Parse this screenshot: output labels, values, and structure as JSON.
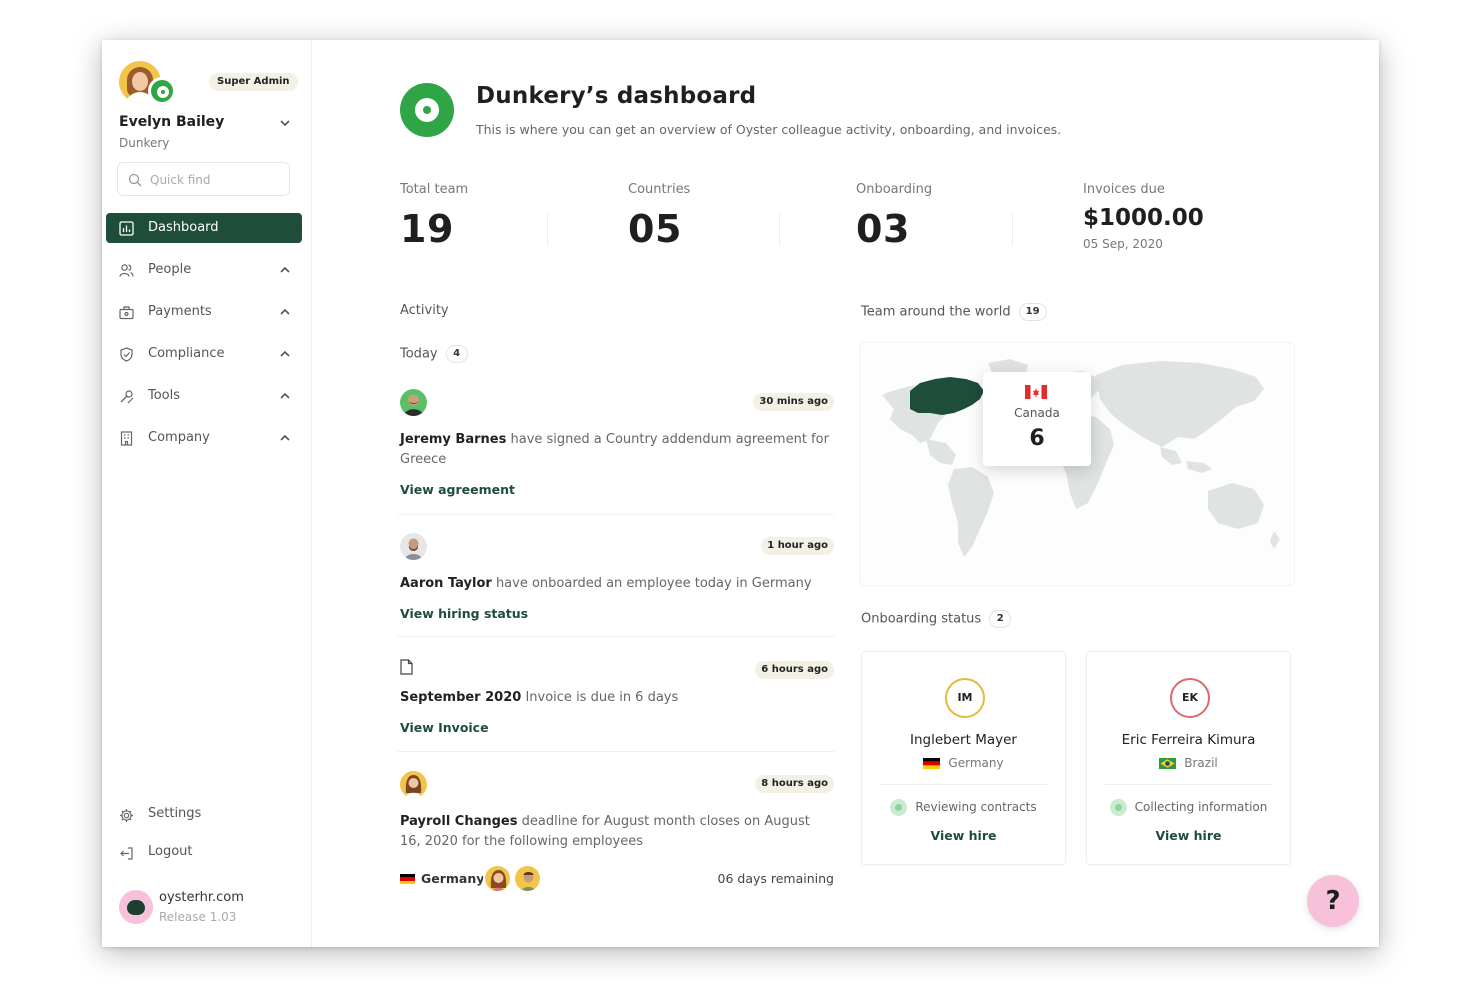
{
  "user": {
    "name": "Evelyn Bailey",
    "company": "Dunkery",
    "role": "Super Admin"
  },
  "search": {
    "placeholder": "Quick find"
  },
  "nav": [
    {
      "label": "Dashboard",
      "icon": "dashboard-icon",
      "active": true
    },
    {
      "label": "People",
      "icon": "people-icon"
    },
    {
      "label": "Payments",
      "icon": "payments-icon"
    },
    {
      "label": "Compliance",
      "icon": "shield-icon"
    },
    {
      "label": "Tools",
      "icon": "tools-icon"
    },
    {
      "label": "Company",
      "icon": "building-icon"
    }
  ],
  "bottom_nav": [
    {
      "label": "Settings",
      "icon": "gear-icon"
    },
    {
      "label": "Logout",
      "icon": "logout-icon"
    }
  ],
  "brand": {
    "site": "oysterhr.com",
    "release": "Release 1.03"
  },
  "header": {
    "title": "Dunkery’s dashboard",
    "subtitle": "This is where you can get an overview of Oyster colleague activity, onboarding, and invoices."
  },
  "stats": {
    "total_team": {
      "label": "Total team",
      "value": "19"
    },
    "countries": {
      "label": "Countries",
      "value": "05"
    },
    "onboarding": {
      "label": "Onboarding",
      "value": "03"
    },
    "invoices": {
      "label": "Invoices due",
      "value": "$1000.00",
      "date": "05 Sep, 2020"
    }
  },
  "activity": {
    "title": "Activity",
    "today_label": "Today",
    "today_count": "4",
    "items": [
      {
        "time": "30 mins ago",
        "actor": "Jeremy Barnes",
        "text": "have signed a Country addendum agreement for Greece",
        "link": "View agreement"
      },
      {
        "time": "1 hour ago",
        "actor": "Aaron Taylor",
        "text": "have onboarded an employee today in Germany",
        "link": "View hiring status"
      },
      {
        "time": "6 hours ago",
        "actor": "September 2020",
        "text": "Invoice is due in 6 days",
        "link": "View Invoice"
      },
      {
        "time": "8 hours ago",
        "actor": "Payroll Changes",
        "text": "deadline for August month closes on August 16, 2020 for the following employees",
        "country": "Germany",
        "remaining": "06 days remaining"
      }
    ]
  },
  "world": {
    "title": "Team around the world",
    "count": "19",
    "highlight_country": "Canada",
    "highlight_count": "6",
    "highlight_color": "#1e4d3a",
    "land_color": "#dfe3e1"
  },
  "onboarding_status": {
    "title": "Onboarding status",
    "count": "2",
    "cards": [
      {
        "initials": "IM",
        "name": "Inglebert Mayer",
        "country": "Germany",
        "status": "Reviewing contracts",
        "link": "View hire",
        "ring_color": "#e7b83c"
      },
      {
        "initials": "EK",
        "name": "Eric Ferreira Kimura",
        "country": "Brazil",
        "status": "Collecting information",
        "link": "View hire",
        "ring_color": "#e06868"
      }
    ]
  },
  "help": {
    "label": "?"
  },
  "colors": {
    "primary": "#1e4d3a",
    "accent_green": "#2fa545",
    "pill_bg": "#f3f1e6",
    "help_pink": "#f6c1d9"
  }
}
